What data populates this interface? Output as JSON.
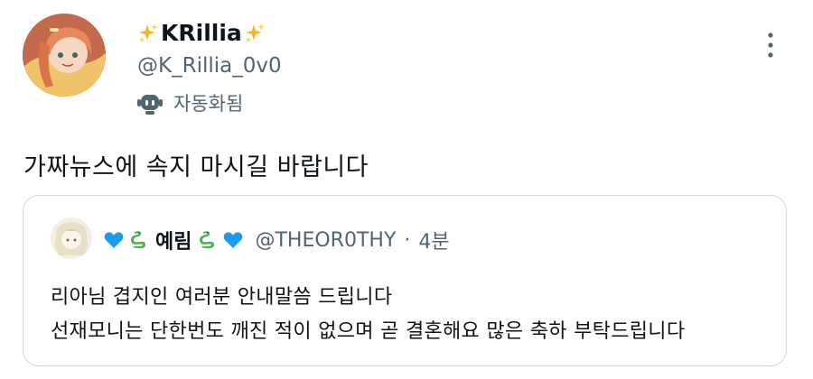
{
  "tweet": {
    "author": {
      "display_name": "KRillia",
      "handle": "@K_Rillia_0v0",
      "automated_label": "자동화됨"
    },
    "text": "가짜뉴스에 속지 마시길 바랍니다"
  },
  "quote": {
    "author": {
      "display_name": "예림",
      "handle": "@THEOR0THY",
      "separator": "·",
      "time": "4분"
    },
    "lines": [
      "리아님 겹지인 여러분 안내말씀 드립니다",
      "선재모니는 단한번도 깨진 적이 없으며 곧 결혼해요 많은 축하 부탁드립니다"
    ]
  },
  "icons": {
    "sparkle": "sparkles-emoji",
    "heart": "blue-heart-emoji",
    "snake": "snake-emoji",
    "robot": "robot-icon",
    "more": "more-vertical-icon"
  },
  "colors": {
    "text": "#0f1419",
    "secondary": "#536471",
    "border": "#cfd9de",
    "heart": "#1d9bf0",
    "snake": "#4caf50"
  }
}
